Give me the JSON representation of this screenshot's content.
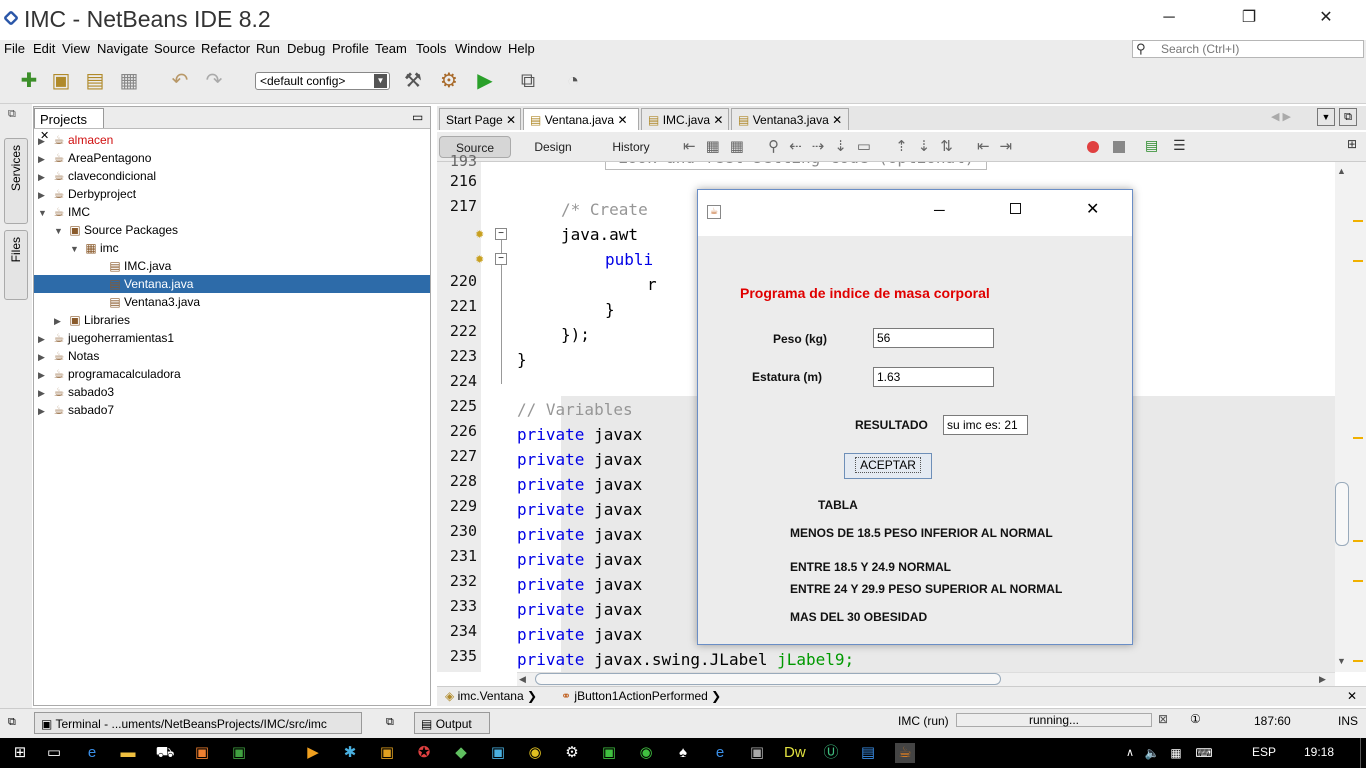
{
  "window": {
    "title": "IMC - NetBeans IDE 8.2",
    "minimize": "─",
    "maximize": "❐",
    "close": "✕"
  },
  "menu": [
    "File",
    "Edit",
    "View",
    "Navigate",
    "Source",
    "Refactor",
    "Run",
    "Debug",
    "Profile",
    "Team",
    "Tools",
    "Window",
    "Help"
  ],
  "search": {
    "placeholder": "Search (Ctrl+I)"
  },
  "toolbar": {
    "config": "<default config>"
  },
  "sidebar": {
    "services": "Services",
    "files": "Files"
  },
  "projects": {
    "tab": "Projects",
    "items": [
      {
        "label": "almacen",
        "toggle": "▶",
        "icon": "☕"
      },
      {
        "label": "AreaPentagono",
        "toggle": "▶",
        "icon": "☕"
      },
      {
        "label": "clavecondicional",
        "toggle": "▶",
        "icon": "☕"
      },
      {
        "label": "Derbyproject",
        "toggle": "▶",
        "icon": "☕"
      },
      {
        "label": "IMC",
        "toggle": "▼",
        "icon": "☕"
      },
      {
        "label": "Source Packages",
        "toggle": "▼",
        "icon": "▣"
      },
      {
        "label": "imc",
        "toggle": "▼",
        "icon": "▦"
      },
      {
        "label": "IMC.java",
        "toggle": "",
        "icon": "▤"
      },
      {
        "label": "Ventana.java",
        "toggle": "",
        "icon": "▤"
      },
      {
        "label": "Ventana3.java",
        "toggle": "",
        "icon": "▤"
      },
      {
        "label": "Libraries",
        "toggle": "▶",
        "icon": "▣"
      },
      {
        "label": "juegoherramientas1",
        "toggle": "▶",
        "icon": "☕"
      },
      {
        "label": "Notas",
        "toggle": "▶",
        "icon": "☕"
      },
      {
        "label": "programacalculadora",
        "toggle": "▶",
        "icon": "☕"
      },
      {
        "label": "sabado3",
        "toggle": "▶",
        "icon": "☕"
      },
      {
        "label": "sabado7",
        "toggle": "▶",
        "icon": "☕"
      }
    ]
  },
  "editor": {
    "tabs": [
      "Start Page",
      "Ventana.java",
      "IMC.java",
      "Ventana3.java"
    ],
    "views": [
      "Source",
      "Design",
      "History"
    ],
    "top_partial": "Look and feel setting code (optional)",
    "lines": [
      {
        "n": "216",
        "code": ""
      },
      {
        "n": "217",
        "code": "/* Create"
      },
      {
        "n": "",
        "code": "java.awt"
      },
      {
        "n": "",
        "code": "publi"
      },
      {
        "n": "220",
        "code": "r"
      },
      {
        "n": "221",
        "code": "}"
      },
      {
        "n": "222",
        "code": "});"
      },
      {
        "n": "223",
        "code": "}"
      },
      {
        "n": "224",
        "code": ""
      },
      {
        "n": "225",
        "code": "// Variables"
      },
      {
        "n": "226",
        "code": "javax"
      },
      {
        "n": "227",
        "code": "javax"
      },
      {
        "n": "228",
        "code": "javax"
      },
      {
        "n": "229",
        "code": "javax"
      },
      {
        "n": "230",
        "code": "javax"
      },
      {
        "n": "231",
        "code": "javax"
      },
      {
        "n": "232",
        "code": "javax"
      },
      {
        "n": "233",
        "code": "javax"
      },
      {
        "n": "234",
        "code": "javax"
      },
      {
        "n": "235",
        "code": "javax.swing.JLabel"
      }
    ],
    "keyword_private": "private",
    "last_var": "jLabel9;",
    "nav": [
      "imc.Ventana",
      "jButton1ActionPerformed"
    ]
  },
  "status": {
    "terminal": "Terminal - ...uments/NetBeansProjects/IMC/src/imc",
    "output": "Output",
    "run_label": "IMC (run)",
    "progress_text": "running...",
    "position": "187:60",
    "mode": "INS"
  },
  "dialog": {
    "title_icon": "java-icon",
    "heading": "Programa de indice de masa corporal",
    "peso_label": "Peso (kg)",
    "peso_value": "56",
    "estatura_label": "Estatura (m)",
    "estatura_value": "1.63",
    "resultado_label": "RESULTADO",
    "resultado_value": "su imc es: 21",
    "button": "ACEPTAR",
    "tabla": "TABLA",
    "rows": [
      "MENOS DE 18.5 PESO INFERIOR AL NORMAL",
      "ENTRE 18.5 Y 24.9 NORMAL",
      "ENTRE 24 Y 29.9 PESO SUPERIOR AL NORMAL",
      "MAS DEL 30 OBESIDAD"
    ],
    "heading_color": "#e00000"
  },
  "taskbar": {
    "lang": "ESP",
    "time": "19:18"
  }
}
